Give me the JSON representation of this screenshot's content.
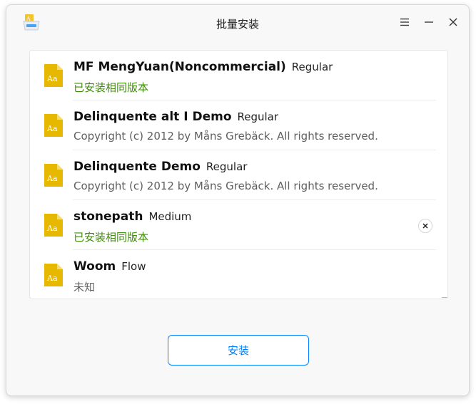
{
  "window": {
    "title": "批量安装",
    "app_icon": "font-installer-app-icon",
    "controls": {
      "menu_icon": "menu-icon",
      "minimize_icon": "minimize-icon",
      "close_icon": "close-icon"
    }
  },
  "fonts": [
    {
      "family": "MF MengYuan(Noncommercial)",
      "style": "Regular",
      "description": "已安装相同版本",
      "status": "installed"
    },
    {
      "family": "Delinquente alt I Demo",
      "style": "Regular",
      "description": "Copyright (c) 2012 by Måns Grebäck. All rights reserved.",
      "status": "new"
    },
    {
      "family": "Delinquente Demo",
      "style": "Regular",
      "description": "Copyright (c) 2012 by Måns Grebäck. All rights reserved.",
      "status": "new"
    },
    {
      "family": "stonepath",
      "style": "Medium",
      "description": "已安装相同版本",
      "status": "installed",
      "hovered": true
    },
    {
      "family": "Woom",
      "style": "Flow",
      "description": "未知",
      "status": "new"
    }
  ],
  "font_file_icon": "font-file-icon",
  "remove_icon": "remove-icon",
  "install_button": {
    "label": "安装"
  },
  "colors": {
    "accent": "#0081ff",
    "installed_text": "#3f8d09",
    "file_icon": "#e6b800"
  }
}
